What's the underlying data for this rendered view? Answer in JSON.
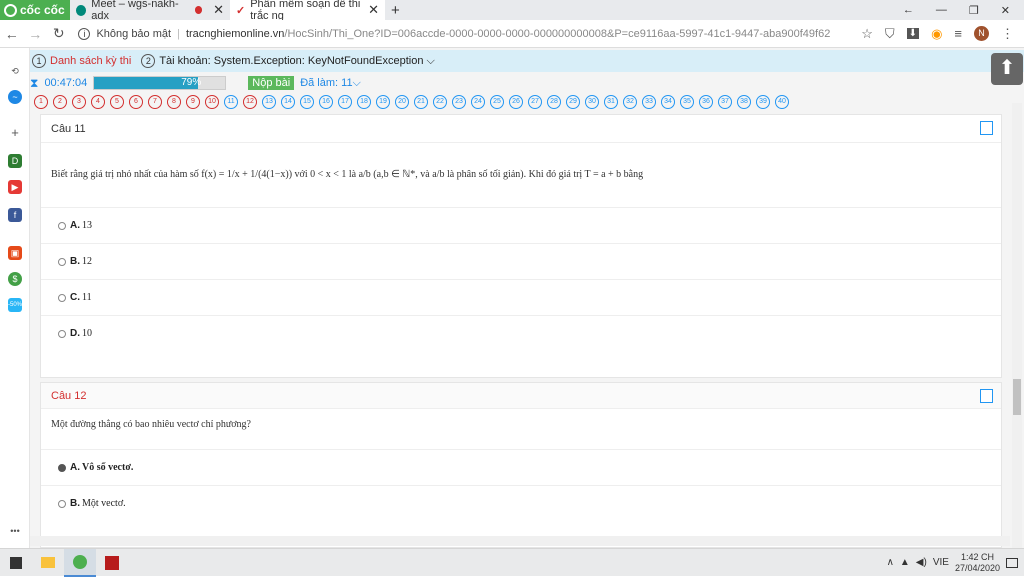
{
  "browser": {
    "brand": "cốc cốc",
    "tabs": [
      {
        "title": "Meet – wgs-nakh-adx"
      },
      {
        "title": "Phần mềm soạn đề thi trắc ng"
      }
    ],
    "address": {
      "security": "Không bảo mật",
      "url_host": "tracnghiemonline.vn",
      "url_path": "/HocSinh/Thi_One?ID=006accde-0000-0000-0000-000000000008&P=ce9116aa-5997-41c1-9447-aba900f49f62"
    },
    "avatar_letter": "N"
  },
  "exam": {
    "step1_num": "1",
    "step1_label": "Danh sách kỳ thi",
    "step2_num": "2",
    "step2_label": "Tài khoản: System.Exception: KeyNotFoundException ⌵",
    "timer": "00:47:04",
    "progress_value": 79,
    "progress_text": "79%",
    "submit_label": "Nộp bài",
    "done_label": "Đã làm: 11⌵",
    "questions_done": [
      "1",
      "2",
      "3",
      "4",
      "5",
      "6",
      "7",
      "8",
      "9",
      "10"
    ],
    "questions_todo": [
      "11",
      "12",
      "13",
      "14",
      "15",
      "16",
      "17",
      "18",
      "19",
      "20",
      "21",
      "22",
      "23",
      "24",
      "25",
      "26",
      "27",
      "28",
      "29",
      "30",
      "31",
      "32",
      "33",
      "34",
      "35",
      "36",
      "37",
      "38",
      "39",
      "40"
    ]
  },
  "q11": {
    "title": "Câu 11",
    "text": "Biết rằng giá trị nhỏ nhất của hàm số f(x) = 1/x + 1/(4(1−x)) với 0 < x < 1 là a/b (a,b ∈ ℕ*, và a/b là phân số tối giản). Khi đó giá trị T = a + b bằng",
    "options": [
      {
        "key": "A.",
        "text": "13"
      },
      {
        "key": "B.",
        "text": "12"
      },
      {
        "key": "C.",
        "text": "11"
      },
      {
        "key": "D.",
        "text": "10"
      }
    ]
  },
  "q12": {
    "title": "Câu 12",
    "text": "Một đường thẳng có bao nhiêu vectơ chỉ phương?",
    "options": [
      {
        "key": "A.",
        "text": "Vô số vectơ.",
        "selected": true
      },
      {
        "key": "B.",
        "text": "Một vectơ."
      }
    ]
  },
  "taskbar": {
    "lang": "VIE",
    "time": "1:42 CH",
    "date": "27/04/2020"
  }
}
